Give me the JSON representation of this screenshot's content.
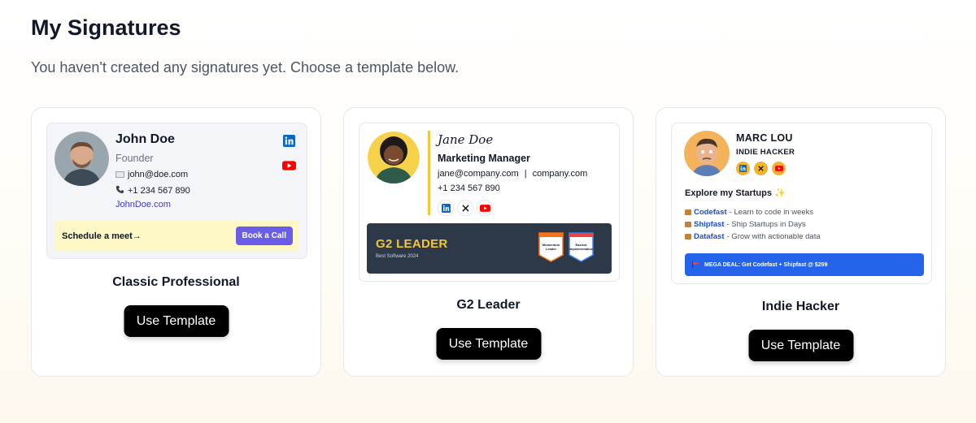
{
  "page": {
    "title": "My Signatures",
    "subtitle": "You haven't created any signatures yet. Choose a template below."
  },
  "templates": [
    {
      "name": "Classic Professional",
      "button": "Use Template",
      "preview": {
        "person_name": "John Doe",
        "role": "Founder",
        "email": "john@doe.com",
        "phone": "+1 234 567 890",
        "website": "JohnDoe.com",
        "cta_text": "Schedule a meet→",
        "cta_button": "Book a Call",
        "social_icons": [
          "linkedin-icon",
          "youtube-icon"
        ]
      }
    },
    {
      "name": "G2 Leader",
      "button": "Use Template",
      "preview": {
        "person_name": "Jane Doe",
        "role": "Marketing Manager",
        "email": "jane@company.com",
        "separator": "|",
        "website": "company.com",
        "phone": "+1 234 567 890",
        "social_icons": [
          "linkedin-icon",
          "x-icon",
          "youtube-icon"
        ],
        "banner_title": "G2 LEADER",
        "banner_subtitle": "Best Software 2024",
        "badges": [
          {
            "label": "Momentum Leader"
          },
          {
            "label": "Easiest Implementation"
          }
        ]
      }
    },
    {
      "name": "Indie Hacker",
      "button": "Use Template",
      "preview": {
        "person_name": "MARC LOU",
        "role": "INDIE HACKER",
        "social_icons": [
          "linkedin-icon",
          "x-icon",
          "youtube-icon"
        ],
        "explore_title": "Explore my Startups ✨",
        "startups": [
          {
            "name": "Codefast",
            "desc": " - Learn to code in weeks"
          },
          {
            "name": "Shipfast",
            "desc": " - Ship Startups in Days"
          },
          {
            "name": "Datafast",
            "desc": " - Grow with actionable data"
          }
        ],
        "deal_text": "MEGA DEAL: Get Codefast + Shipfast @ $299"
      }
    }
  ],
  "colors": {
    "accent_purple": "#6a5ee8",
    "g2_gold": "#f4c536",
    "deal_blue": "#2563eb",
    "linkedin_blue": "#0a66c2",
    "youtube_red": "#ff0000"
  }
}
